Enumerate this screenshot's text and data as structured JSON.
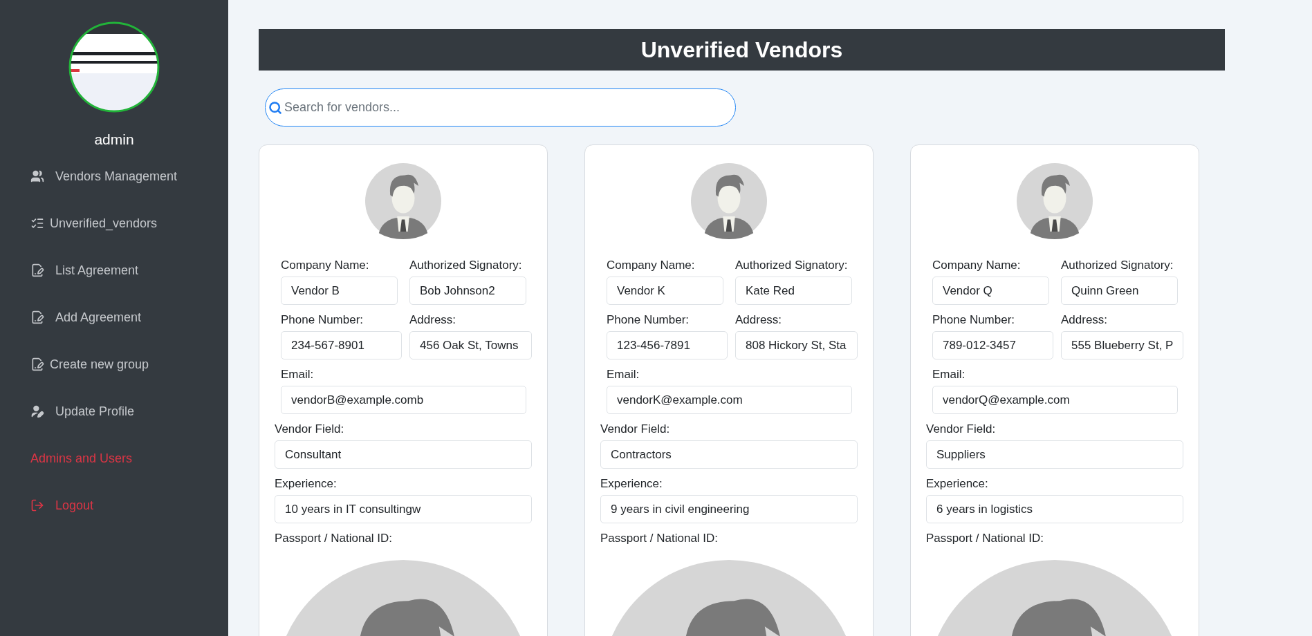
{
  "sidebar": {
    "user_name": "admin",
    "items": [
      {
        "label": "Vendors Management",
        "kind": "group"
      },
      {
        "label": "Unverified_vendors",
        "kind": "checklist"
      },
      {
        "label": "List Agreement",
        "kind": "document"
      },
      {
        "label": "Add Agreement",
        "kind": "document"
      },
      {
        "label": "Create new group",
        "kind": "document"
      },
      {
        "label": "Update Profile",
        "kind": "user-edit"
      },
      {
        "label": "Admins and Users",
        "kind": "alert"
      },
      {
        "label": "Logout",
        "kind": "logout"
      }
    ]
  },
  "header": {
    "title": "Unverified Vendors"
  },
  "search": {
    "placeholder": "Search for vendors..."
  },
  "vendors": [
    {
      "company_label": "Company Name:",
      "company": "Vendor B",
      "signatory_label": "Authorized Signatory:",
      "signatory": "Bob Johnson2",
      "phone_label": "Phone Number:",
      "phone": "234-567-8901",
      "address_label": "Address:",
      "address": "456 Oak St, Towns",
      "email_label": "Email:",
      "email": "vendorB@example.comb",
      "field_label": "Vendor Field:",
      "field": "Consultant",
      "experience_label": "Experience:",
      "experience": "10 years in IT consultingw",
      "passport_label": "Passport / National ID:"
    },
    {
      "company_label": "Company Name:",
      "company": "Vendor K",
      "signatory_label": "Authorized Signatory:",
      "signatory": "Kate Red",
      "phone_label": "Phone Number:",
      "phone": "123-456-7891",
      "address_label": "Address:",
      "address": "808 Hickory St, Sta",
      "email_label": "Email:",
      "email": "vendorK@example.com",
      "field_label": "Vendor Field:",
      "field": "Contractors",
      "experience_label": "Experience:",
      "experience": "9 years in civil engineering",
      "passport_label": "Passport / National ID:"
    },
    {
      "company_label": "Company Name:",
      "company": "Vendor Q",
      "signatory_label": "Authorized Signatory:",
      "signatory": "Quinn Green",
      "phone_label": "Phone Number:",
      "phone": "789-012-3457",
      "address_label": "Address:",
      "address": "555 Blueberry St, P",
      "email_label": "Email:",
      "email": "vendorQ@example.com",
      "field_label": "Vendor Field:",
      "field": "Suppliers",
      "experience_label": "Experience:",
      "experience": "6 years in logistics",
      "passport_label": "Passport / National ID:"
    }
  ]
}
